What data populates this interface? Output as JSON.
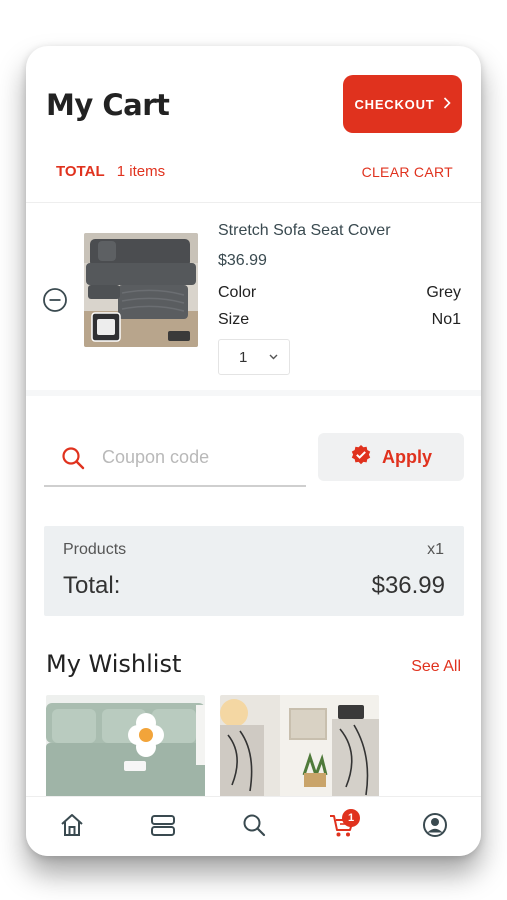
{
  "header": {
    "title": "My Cart",
    "checkout_label": "CHECKOUT"
  },
  "summary_bar": {
    "total_label": "TOTAL",
    "items_text": "1 items",
    "clear_cart_label": "CLEAR CART"
  },
  "cart": {
    "items": [
      {
        "name": "Stretch Sofa Seat Cover",
        "price": "$36.99",
        "attributes": [
          {
            "label": "Color",
            "value": "Grey"
          },
          {
            "label": "Size",
            "value": "No1"
          }
        ],
        "quantity": "1",
        "image_icon": "sofa-image"
      }
    ]
  },
  "coupon": {
    "placeholder": "Coupon code",
    "value": "",
    "apply_label": "Apply"
  },
  "order_summary": {
    "products_label": "Products",
    "products_count": "x1",
    "total_label": "Total:",
    "total_value": "$36.99"
  },
  "wishlist": {
    "title": "My Wishlist",
    "see_all_label": "See All"
  },
  "bottom_nav": {
    "icons": [
      "home-icon",
      "categories-icon",
      "search-icon",
      "cart-icon",
      "profile-icon"
    ],
    "cart_badge": "1"
  },
  "colors": {
    "accent": "#e0321e",
    "text_dark": "#222222",
    "text_muted": "#3a4a50",
    "summary_bg": "#edf0f2"
  }
}
